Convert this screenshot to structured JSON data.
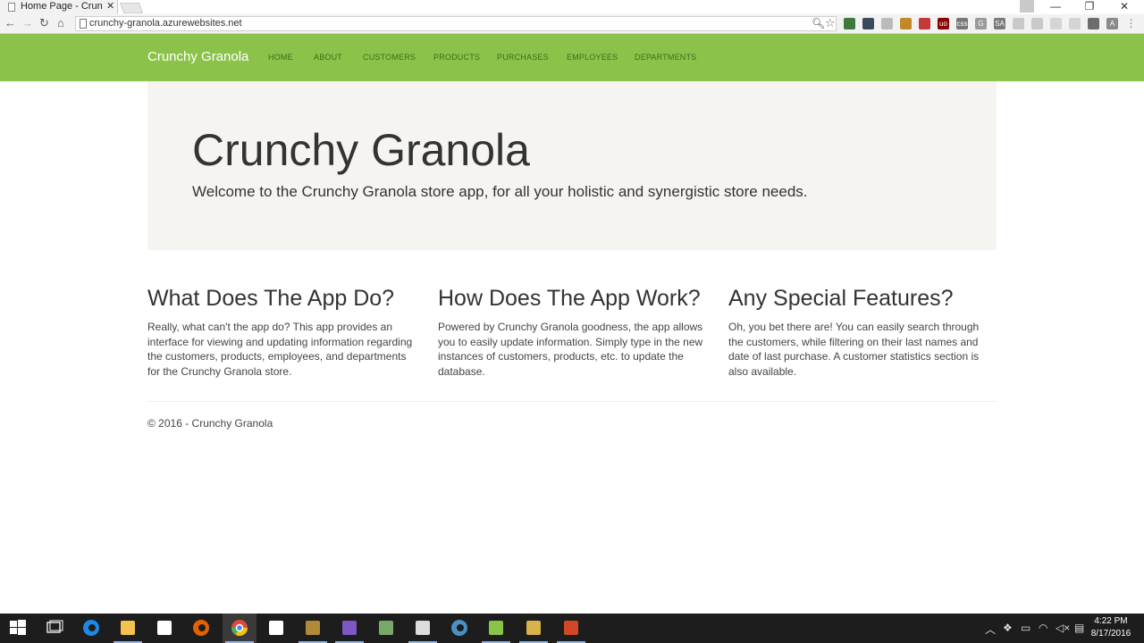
{
  "browser": {
    "tab_title": "Home Page - Crunch",
    "tab_close": "✕",
    "url": "crunchy-granola.azurewebsites.net",
    "back": "←",
    "forward": "→",
    "reload": "↻",
    "home": "⌂",
    "minimize": "—",
    "maximize": "❐",
    "close": "✕"
  },
  "extensions": [
    {
      "icon": "shield-check-icon",
      "color": "#3d7a3d",
      "label": ""
    },
    {
      "icon": "dashed-box-icon",
      "color": "#3b4a5a",
      "label": ""
    },
    {
      "icon": "bulb-icon",
      "color": "#bbbbbb",
      "label": ""
    },
    {
      "icon": "hand-icon",
      "color": "#c08a2a",
      "label": ""
    },
    {
      "icon": "grid-icon",
      "color": "#c23a3a",
      "label": ""
    },
    {
      "icon": "ublock-icon",
      "color": "#8b0000",
      "label": "uo"
    },
    {
      "icon": "css-icon",
      "color": "#777777",
      "label": "css"
    },
    {
      "icon": "g-icon",
      "color": "#9a9a9a",
      "label": "G"
    },
    {
      "icon": "sa-icon",
      "color": "#7a7a7a",
      "label": "SA"
    },
    {
      "icon": "grey-box-icon",
      "color": "#c9c9c9",
      "label": ""
    },
    {
      "icon": "grey-box-icon",
      "color": "#c9c9c9",
      "label": ""
    },
    {
      "icon": "grey-arrow-icon",
      "color": "#d5d5d5",
      "label": ""
    },
    {
      "icon": "grey-swirl-icon",
      "color": "#d5d5d5",
      "label": ""
    },
    {
      "icon": "chat-icon",
      "color": "#6c6c6c",
      "label": ""
    },
    {
      "icon": "a-icon",
      "color": "#8a8a8a",
      "label": "A"
    },
    {
      "icon": "menu-icon",
      "color": "#777777",
      "label": "⋮"
    }
  ],
  "navbar": {
    "brand": "Crunchy Granola",
    "links": [
      "HOME",
      "ABOUT",
      "CUSTOMERS",
      "PRODUCTS",
      "PURCHASES",
      "EMPLOYEES",
      "DEPARTMENTS"
    ]
  },
  "jumbotron": {
    "title": "Crunchy Granola",
    "lead": "Welcome to the Crunchy Granola store app, for all your holistic and synergistic store needs."
  },
  "columns": [
    {
      "heading": "What Does The App Do?",
      "text": "Really, what can't the app do? This app provides an interface for viewing and updating information regarding the customers, products, employees, and departments for the Crunchy Granola store."
    },
    {
      "heading": "How Does The App Work?",
      "text": "Powered by Crunchy Granola goodness, the app allows you to easily update information. Simply type in the new instances of customers, products, etc. to update the database."
    },
    {
      "heading": "Any Special Features?",
      "text": "Oh, you bet there are! You can easily search through the customers, while filtering on their last names and date of last purchase. A customer statistics section is also available."
    }
  ],
  "footer": "© 2016 - Crunchy Granola",
  "taskbar": {
    "apps": [
      {
        "icon": "windows-start-icon",
        "color": "#ffffff"
      },
      {
        "icon": "task-view-icon",
        "color": "#ffffff"
      },
      {
        "icon": "edge-icon",
        "color": "#1e88e5"
      },
      {
        "icon": "file-explorer-icon",
        "color": "#f2c14e"
      },
      {
        "icon": "store-icon",
        "color": "#ffffff"
      },
      {
        "icon": "firefox-icon",
        "color": "#e66000"
      },
      {
        "icon": "chrome-icon",
        "color": "#dd4b39"
      },
      {
        "icon": "settings-icon",
        "color": "#ffffff"
      },
      {
        "icon": "app-icon",
        "color": "#b08a3a"
      },
      {
        "icon": "visual-studio-icon",
        "color": "#7e57c2"
      },
      {
        "icon": "git-icon",
        "color": "#7aa86a"
      },
      {
        "icon": "terminal-icon",
        "color": "#dddddd"
      },
      {
        "icon": "globe-icon",
        "color": "#4a90c2"
      },
      {
        "icon": "notepad-icon",
        "color": "#8bc34a"
      },
      {
        "icon": "tools-icon",
        "color": "#d8b24a"
      },
      {
        "icon": "powerpoint-icon",
        "color": "#d24726"
      }
    ],
    "time": "4:22 PM",
    "date": "8/17/2016"
  }
}
